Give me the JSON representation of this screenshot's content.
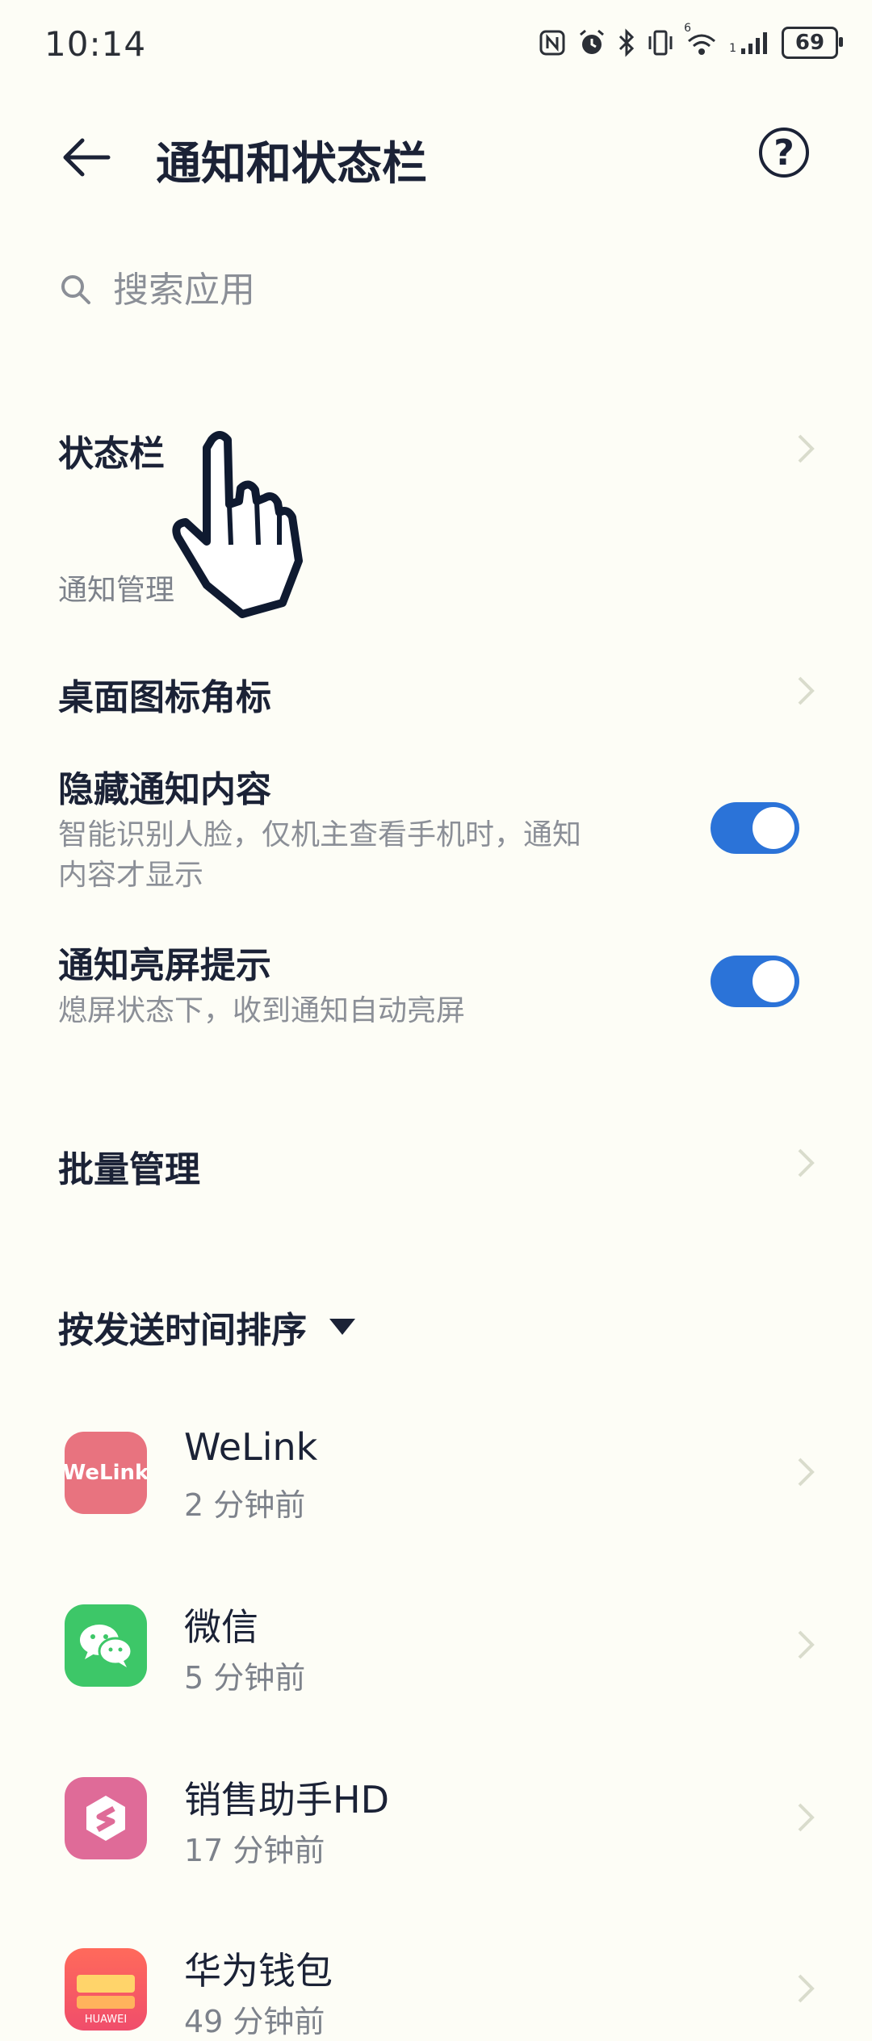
{
  "status_bar": {
    "time": "10:14",
    "signal_label": "1",
    "wifi_label": "6",
    "battery": "69",
    "icons": [
      "nfc-icon",
      "alarm-icon",
      "bluetooth-icon",
      "vibrate-icon",
      "wifi-icon",
      "signal-icon",
      "battery-icon"
    ]
  },
  "header": {
    "title": "通知和状态栏",
    "help": "?"
  },
  "search": {
    "placeholder": "搜索应用"
  },
  "rows": {
    "status_bar": "状态栏",
    "section_label": "通知管理",
    "badges": "桌面图标角标",
    "hide_content": {
      "title": "隐藏通知内容",
      "subtitle_line1": "智能识别人脸，仅机主查看手机时，通知",
      "subtitle_line2": "内容才显示",
      "enabled": true
    },
    "wake_screen": {
      "title": "通知亮屏提示",
      "subtitle": "熄屏状态下，收到通知自动亮屏",
      "enabled": true
    },
    "batch": "批量管理"
  },
  "sort": {
    "label": "按发送时间排序"
  },
  "apps": [
    {
      "name": "WeLink",
      "time": "2 分钟前",
      "icon": "welink-icon",
      "icon_text": "WeLink",
      "color": "#e8737f"
    },
    {
      "name": "微信",
      "time": "5 分钟前",
      "icon": "wechat-icon",
      "color": "#3dc768"
    },
    {
      "name": "销售助手HD",
      "time": "17 分钟前",
      "icon": "sales-assistant-icon",
      "color": "#df6b98"
    },
    {
      "name": "华为钱包",
      "time": "49 分钟前",
      "icon": "huawei-wallet-icon",
      "icon_text": "HUAWEI",
      "color": "#ee5b5b"
    }
  ],
  "colors": {
    "background": "#fdfdf6",
    "accent": "#2b73d8",
    "text": "#1b2236",
    "secondary": "#8b8f97"
  }
}
